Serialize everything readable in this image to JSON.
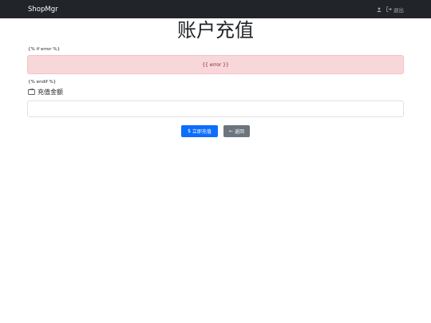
{
  "navbar": {
    "brand": "ShopMgr",
    "user_icon": "user-icon",
    "logout_icon": "logout-icon",
    "logout_label": "退出"
  },
  "page": {
    "title": "账户充值"
  },
  "template": {
    "if_error": "{% if error %}",
    "error_placeholder": "{{ error }}",
    "endif": "{% endif %}"
  },
  "form": {
    "amount_icon": "wallet-icon",
    "amount_label": "充值金额",
    "amount_value": ""
  },
  "buttons": {
    "submit_icon": "dollar-icon",
    "submit_label": "立即充值",
    "back_icon": "arrow-left-icon",
    "back_label": "返回"
  },
  "colors": {
    "navbar_bg": "#212529",
    "alert_bg": "#f8d7da",
    "alert_text": "#842029",
    "primary": "#0d6efd",
    "secondary": "#6c757d"
  }
}
